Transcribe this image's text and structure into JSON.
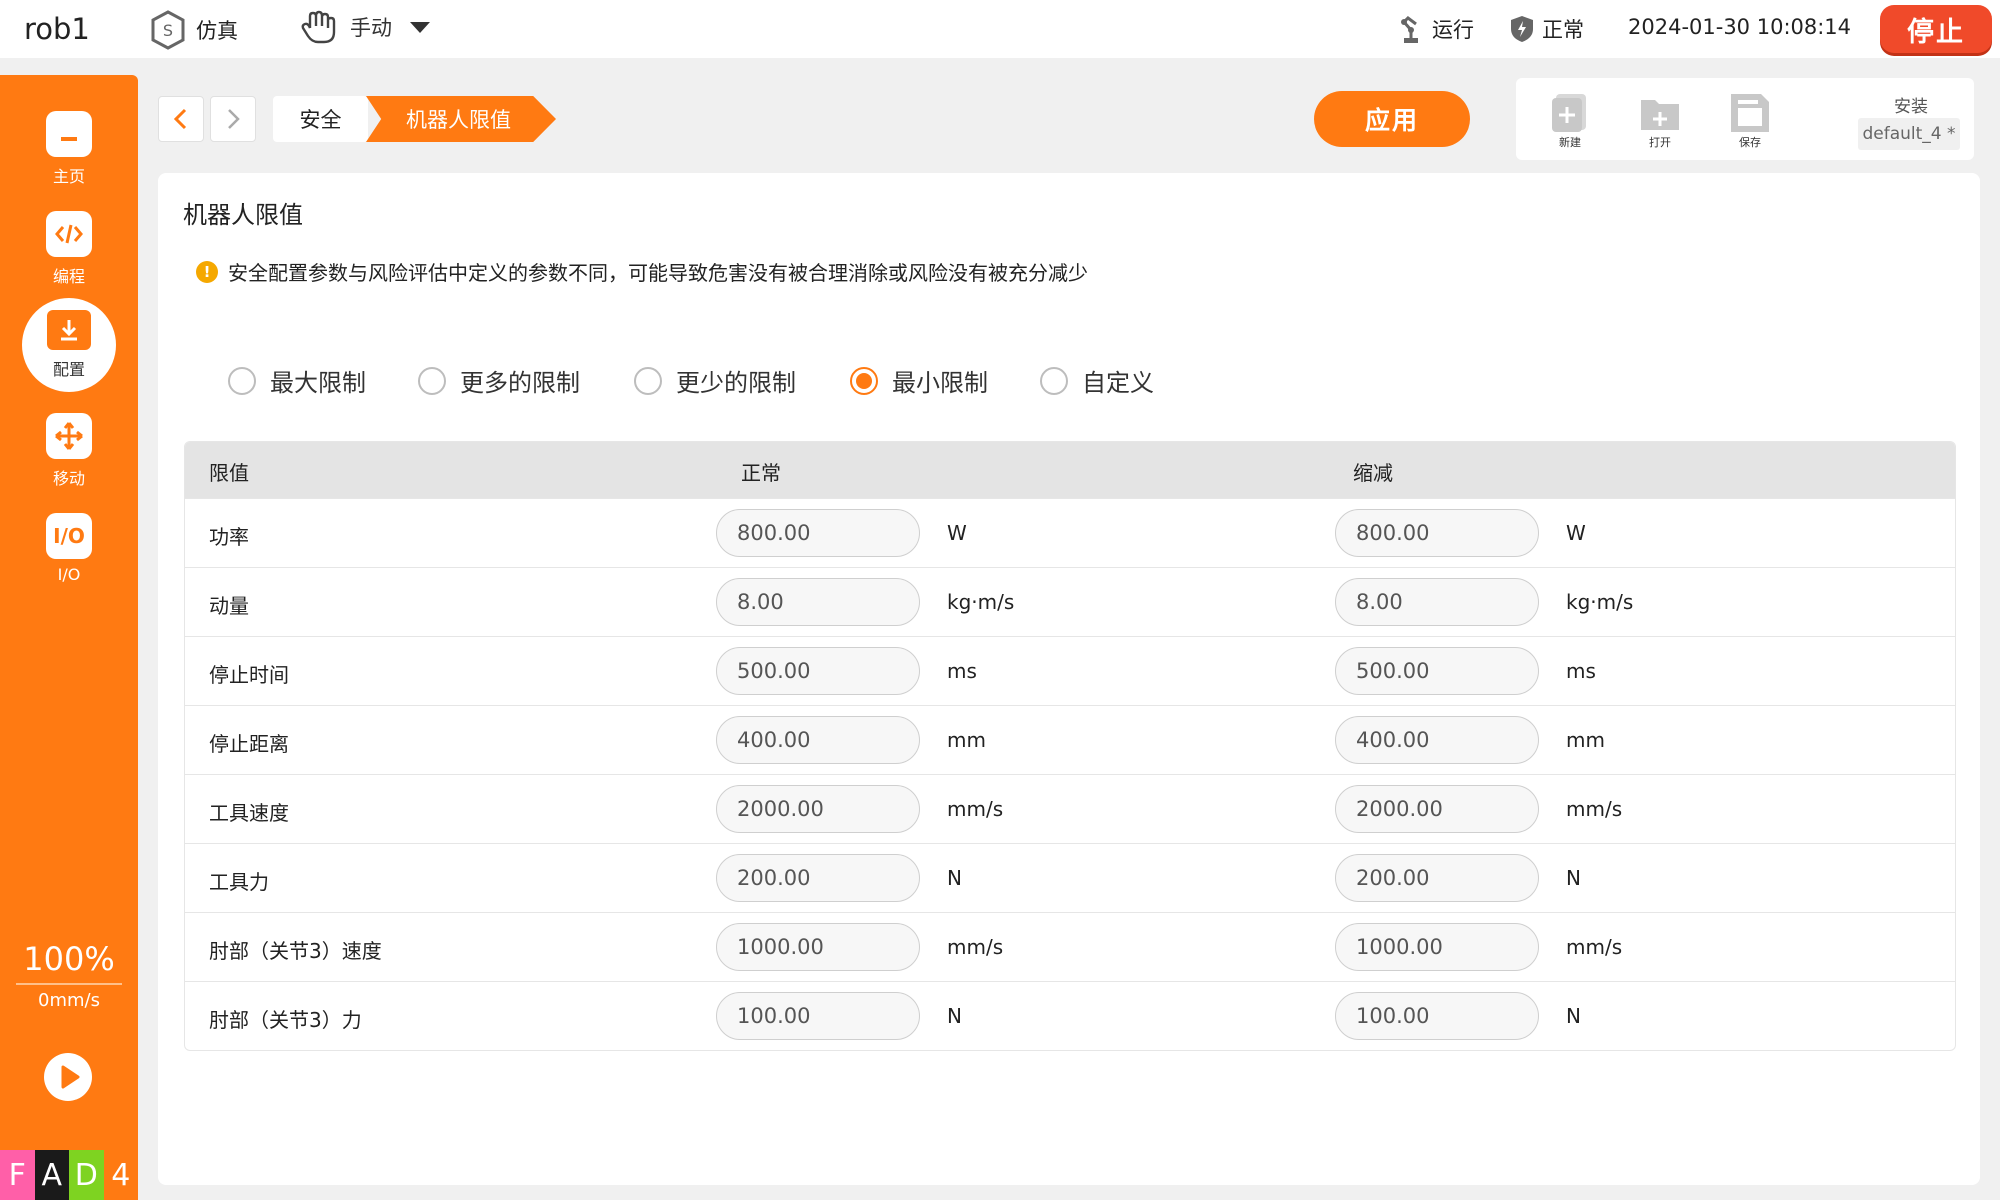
{
  "topbar": {
    "robot_name": "rob1",
    "sim_label": "仿真",
    "mode_label": "手动",
    "run_label": "运行",
    "normal_label": "正常",
    "datetime": "2024-01-30 10:08:14",
    "stop_label": "停止"
  },
  "sidebar": {
    "items": [
      {
        "label": "主页",
        "icon": "home-icon"
      },
      {
        "label": "编程",
        "icon": "code-icon"
      },
      {
        "label": "配置",
        "icon": "config-icon"
      },
      {
        "label": "移动",
        "icon": "move-icon"
      },
      {
        "label": "I/O",
        "icon": "io-icon"
      }
    ],
    "io_glyph": "I/O",
    "speed_percent": "100%",
    "speed_value": "0mm/s",
    "fad": [
      "F",
      "A",
      "D",
      "4"
    ],
    "fad_colors": [
      "#ff5fa8",
      "#1a1a1a",
      "#7ed321",
      "#ff7a12"
    ]
  },
  "breadcrumb": {
    "items": [
      "安全",
      "机器人限值"
    ]
  },
  "actions": {
    "apply_label": "应用",
    "new_label": "新建",
    "open_label": "打开",
    "save_label": "保存",
    "install_label": "安装",
    "install_value": "default_4 *"
  },
  "panel": {
    "title": "机器人限值",
    "warning": "安全配置参数与风险评估中定义的参数不同，可能导致危害没有被合理消除或风险没有被充分减少",
    "options": [
      "最大限制",
      "更多的限制",
      "更少的限制",
      "最小限制",
      "自定义"
    ],
    "selected_option": "最小限制",
    "table": {
      "headers": [
        "限值",
        "正常",
        "缩减"
      ],
      "rows": [
        {
          "name": "功率",
          "normal": "800.00",
          "reduced": "800.00",
          "unit": "W"
        },
        {
          "name": "动量",
          "normal": "8.00",
          "reduced": "8.00",
          "unit": "kg·m/s"
        },
        {
          "name": "停止时间",
          "normal": "500.00",
          "reduced": "500.00",
          "unit": "ms"
        },
        {
          "name": "停止距离",
          "normal": "400.00",
          "reduced": "400.00",
          "unit": "mm"
        },
        {
          "name": "工具速度",
          "normal": "2000.00",
          "reduced": "2000.00",
          "unit": "mm/s"
        },
        {
          "name": "工具力",
          "normal": "200.00",
          "reduced": "200.00",
          "unit": "N"
        },
        {
          "name": "肘部（关节3）速度",
          "normal": "1000.00",
          "reduced": "1000.00",
          "unit": "mm/s"
        },
        {
          "name": "肘部（关节3）力",
          "normal": "100.00",
          "reduced": "100.00",
          "unit": "N"
        }
      ]
    }
  },
  "colors": {
    "accent": "#ff7a12",
    "stop": "#f04a2a",
    "warning": "#f5a800"
  }
}
